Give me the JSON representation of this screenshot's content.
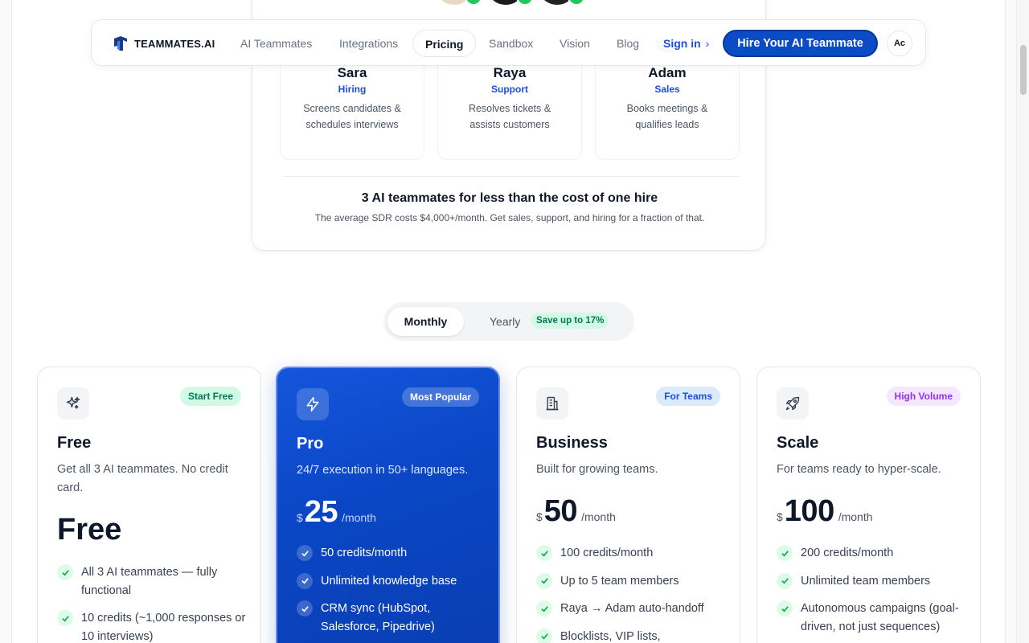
{
  "nav": {
    "brand": "TEAMMATES.AI",
    "links": [
      "AI Teammates",
      "Integrations",
      "Pricing",
      "Sandbox",
      "Vision",
      "Blog"
    ],
    "active": "Pricing",
    "signin": "Sign in",
    "cta": "Hire Your AI Teammate",
    "lang": "Aᴄ"
  },
  "hero": {
    "teammates": [
      {
        "name": "Sara",
        "role": "Hiring",
        "desc": "Screens candidates & schedules interviews",
        "color": "#10b981"
      },
      {
        "name": "Raya",
        "role": "Support",
        "desc": "Resolves tickets & assists customers",
        "color": "#a855f7"
      },
      {
        "name": "Adam",
        "role": "Sales",
        "desc": "Books meetings & qualifies leads",
        "color": "#3b82f6"
      }
    ],
    "headline": "3 AI teammates for less than the cost of one hire",
    "subtext": "The average SDR costs $4,000+/month. Get sales, support, and hiring for a fraction of that."
  },
  "billing": {
    "monthly": "Monthly",
    "yearly": "Yearly",
    "save": "Save up to 17%"
  },
  "plans": [
    {
      "name": "Free",
      "icon": "sparkles-icon",
      "badge": "Start Free",
      "badge_bg": "#d1fae5",
      "badge_fg": "#047857",
      "desc": "Get all 3 AI teammates. No credit card.",
      "price_text": "Free",
      "features": [
        "All 3 AI teammates — fully functional",
        "10 credits (~1,000 responses or 10 interviews)"
      ]
    },
    {
      "name": "Pro",
      "icon": "lightning-icon",
      "badge": "Most Popular",
      "badge_bg": "rgba(255,255,255,0.22)",
      "badge_fg": "#ffffff",
      "desc": "24/7 execution in 50+ languages.",
      "currency": "$",
      "amount": "25",
      "period": "/month",
      "features": [
        "50 credits/month",
        "Unlimited knowledge base",
        "CRM sync (HubSpot, Salesforce, Pipedrive)"
      ]
    },
    {
      "name": "Business",
      "icon": "building-icon",
      "badge": "For Teams",
      "badge_bg": "#dbeafe",
      "badge_fg": "#1d4ed8",
      "desc": "Built for growing teams.",
      "currency": "$",
      "amount": "50",
      "period": "/month",
      "features": [
        "100 credits/month",
        "Up to 5 team members",
        "Raya → Adam auto-handoff",
        "Blocklists, VIP lists,"
      ]
    },
    {
      "name": "Scale",
      "icon": "rocket-icon",
      "badge": "High Volume",
      "badge_bg": "#f3e8ff",
      "badge_fg": "#9333ea",
      "desc": "For teams ready to hyper-scale.",
      "currency": "$",
      "amount": "100",
      "period": "/month",
      "features": [
        "200 credits/month",
        "Unlimited team members",
        "Autonomous campaigns (goal-driven, not just sequences)"
      ]
    }
  ]
}
